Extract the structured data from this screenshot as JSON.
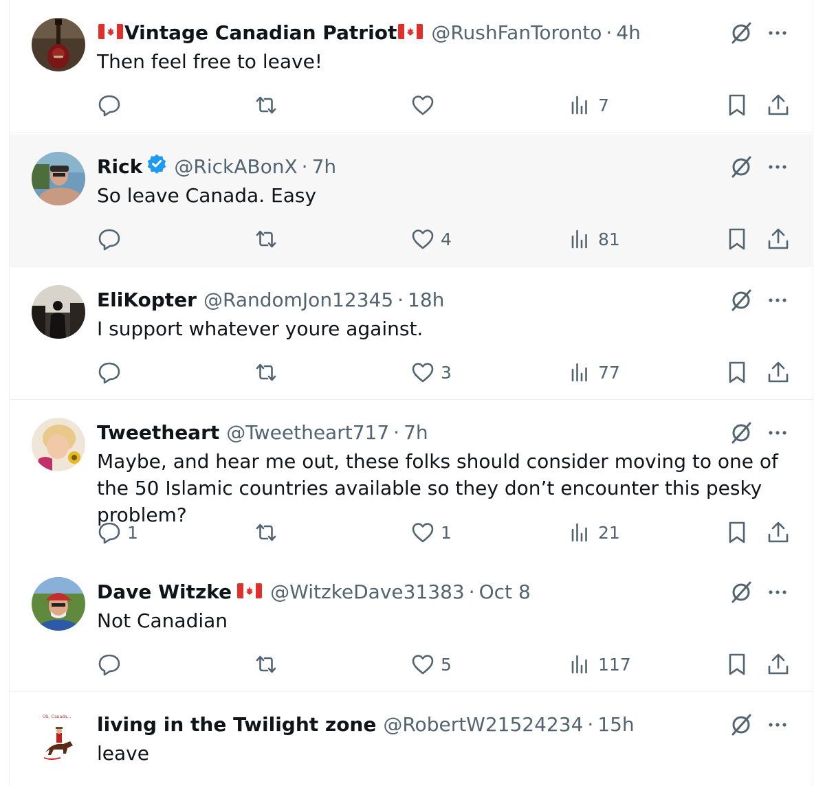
{
  "tweets": [
    {
      "name": "Vintage Canadian Patriot",
      "flags": "both",
      "verified": false,
      "handle": "@RushFanToronto",
      "time": "4h",
      "text": "Then feel free to leave!",
      "replies": "",
      "likes": "",
      "views": "7",
      "avatar_icon": "guitar-avatar"
    },
    {
      "name": "Rick",
      "flags": "none",
      "verified": true,
      "handle": "@RickABonX",
      "time": "7h",
      "text": "So leave Canada. Easy",
      "replies": "",
      "likes": "4",
      "views": "81",
      "avatar_icon": "man-photo-avatar"
    },
    {
      "name": "EliKopter",
      "flags": "none",
      "verified": false,
      "handle": "@RandomJon12345",
      "time": "18h",
      "text": "I support whatever youre against.",
      "replies": "",
      "likes": "3",
      "views": "77",
      "avatar_icon": "silhouette-avatar"
    },
    {
      "name": "Tweetheart",
      "flags": "none",
      "verified": false,
      "handle": "@Tweetheart717",
      "time": "7h",
      "text": "Maybe, and hear me out, these folks should consider moving to one of the 50 Islamic countries available so they don’t encounter this pesky problem?",
      "replies": "1",
      "likes": "1",
      "views": "21",
      "avatar_icon": "child-avatar"
    },
    {
      "name": "Dave Witzke",
      "flags": "after",
      "verified": false,
      "handle": "@WitzkeDave31383",
      "time": "Oct 8",
      "text": "Not Canadian",
      "replies": "",
      "likes": "5",
      "views": "117",
      "avatar_icon": "man-cap-avatar"
    },
    {
      "name": "living in the Twilight zone",
      "flags": "none",
      "verified": false,
      "handle": "@RobertW21524234",
      "time": "15h",
      "text": "leave",
      "replies": "",
      "likes": "",
      "views": "",
      "avatar_icon": "mountie-avatar",
      "avatar_caption": "Oh, Canada..."
    }
  ],
  "colors": {
    "text": "#0f1419",
    "muted": "#536471",
    "verified": "#1d9bf0",
    "flag_red": "#e0302c",
    "divider": "#eff3f4",
    "hover_bg": "#f7f7f7"
  },
  "icons": {
    "grok": "grok-slash-icon",
    "more": "more-dots-icon",
    "reply": "reply-icon",
    "retweet": "retweet-icon",
    "like": "heart-icon",
    "views": "views-bar-icon",
    "bookmark": "bookmark-icon",
    "share": "share-icon"
  }
}
